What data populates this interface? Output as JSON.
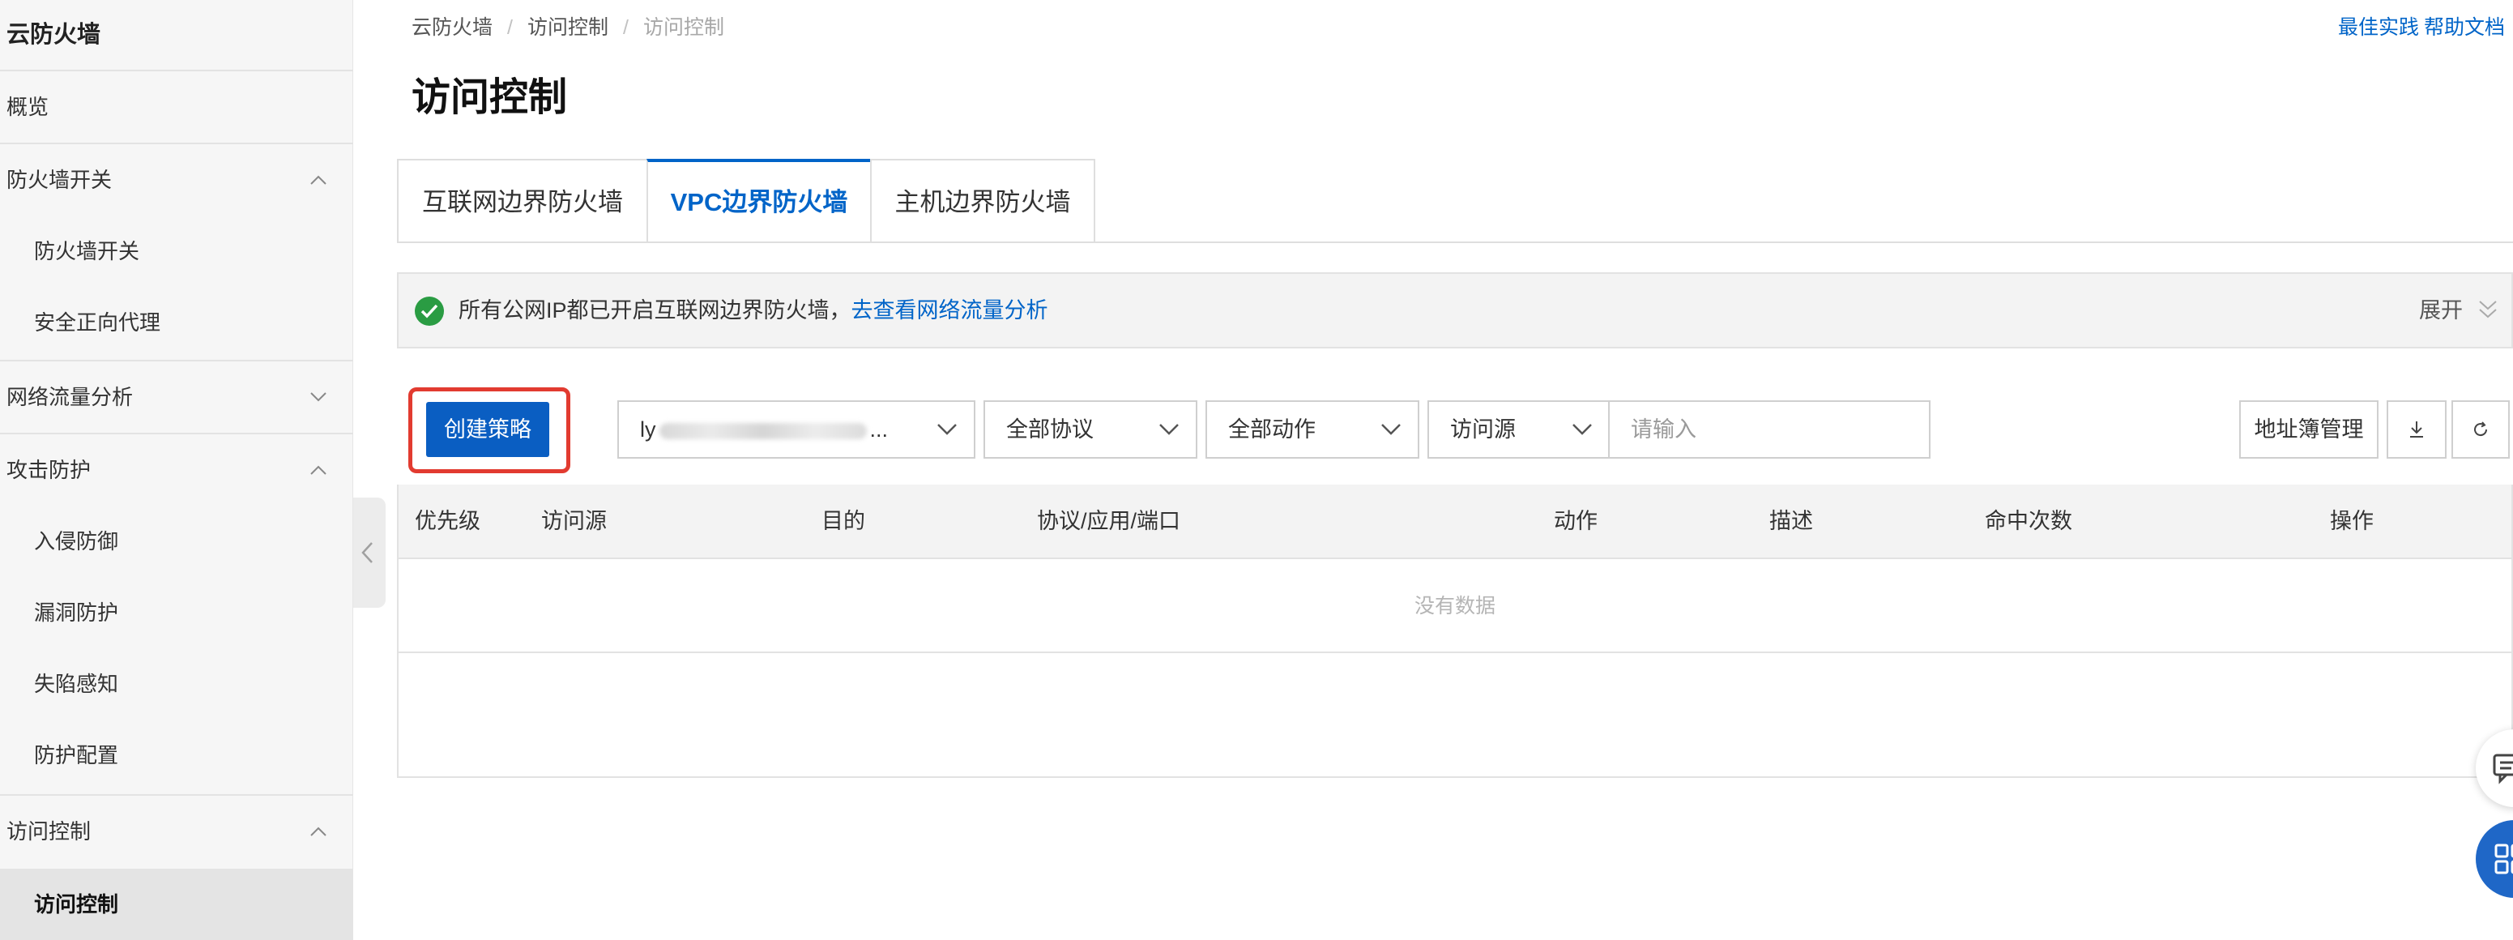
{
  "sidebar": {
    "title": "云防火墙",
    "items": [
      {
        "label": "概览",
        "level": 1
      },
      {
        "label": "防火墙开关",
        "level": 1,
        "expanded": true
      },
      {
        "label": "防火墙开关",
        "level": 2
      },
      {
        "label": "安全正向代理",
        "level": 2
      },
      {
        "label": "网络流量分析",
        "level": 1,
        "expanded": false
      },
      {
        "label": "攻击防护",
        "level": 1,
        "expanded": true
      },
      {
        "label": "入侵防御",
        "level": 2
      },
      {
        "label": "漏洞防护",
        "level": 2
      },
      {
        "label": "失陷感知",
        "level": 2
      },
      {
        "label": "防护配置",
        "level": 2
      },
      {
        "label": "访问控制",
        "level": 1,
        "expanded": true
      },
      {
        "label": "访问控制",
        "level": 2,
        "active": true
      }
    ]
  },
  "breadcrumb": [
    "云防火墙",
    "访问控制",
    "访问控制"
  ],
  "top_links": [
    "最佳实践",
    "帮助文档"
  ],
  "page_title": "访问控制",
  "tabs": [
    {
      "label": "互联网边界防火墙",
      "active": false
    },
    {
      "label": "VPC边界防火墙",
      "active": true
    },
    {
      "label": "主机边界防火墙",
      "active": false
    }
  ],
  "notice": {
    "message": "所有公网IP都已开启互联网边界防火墙，",
    "link": "去查看网络流量分析",
    "expand_label": "展开",
    "status_color": "#2a9c43"
  },
  "toolbar": {
    "create_button": "创建策略",
    "vpc_select": {
      "prefix": "ly",
      "suffix": "..."
    },
    "protocol_select": "全部协议",
    "action_select": "全部动作",
    "field_select": "访问源",
    "search_placeholder": "请输入",
    "address_book_button": "地址簿管理",
    "download_icon": "download-icon",
    "refresh_icon": "refresh-icon"
  },
  "table": {
    "columns": [
      "优先级",
      "访问源",
      "目的",
      "协议/应用/端口",
      "动作",
      "描述",
      "命中次数",
      "操作"
    ],
    "rows": [],
    "empty_text": "没有数据"
  },
  "colors": {
    "accent": "#0064c8",
    "primary_button": "#0a5ec2",
    "highlight_border": "#e23b30"
  }
}
